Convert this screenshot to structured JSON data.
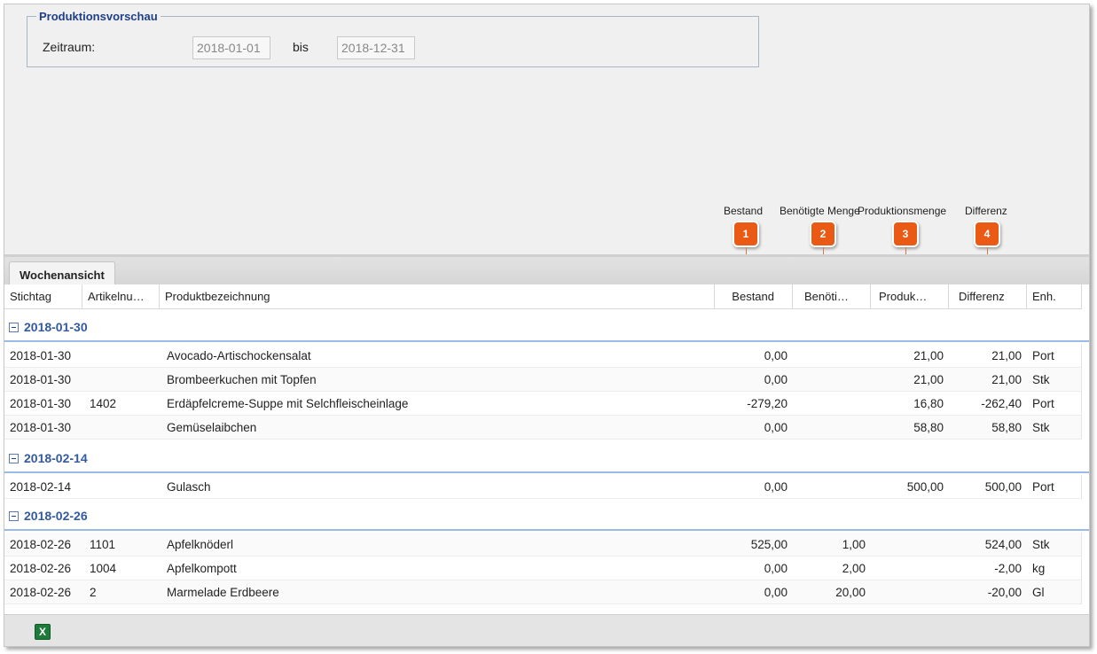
{
  "filter": {
    "legend": "Produktionsvorschau",
    "period_label": "Zeitraum:",
    "date_from": "2018-01-01",
    "to_label": "bis",
    "date_to": "2018-12-31"
  },
  "callouts": [
    {
      "number": "1",
      "label": "Bestand"
    },
    {
      "number": "2",
      "label": "Benötigte Menge"
    },
    {
      "number": "3",
      "label": "Produktionsmenge"
    },
    {
      "number": "4",
      "label": "Differenz"
    }
  ],
  "tabs": [
    {
      "label": "Wochenansicht"
    }
  ],
  "columns": {
    "stichtag": "Stichtag",
    "artikelnummer": "Artikelnu…",
    "produktbezeichnung": "Produktbezeichnung",
    "bestand": "Bestand",
    "benoetigt": "Benöti…",
    "produktion": "Produk…",
    "differenz": "Differenz",
    "einheit": "Enh."
  },
  "groups": [
    {
      "title": "2018-01-30",
      "rows": [
        {
          "stichtag": "2018-01-30",
          "artikelnummer": "",
          "produkt": "Avocado-Artischockensalat",
          "bestand": "0,00",
          "benoetigt": "",
          "produktion": "21,00",
          "differenz": "21,00",
          "einheit": "Port"
        },
        {
          "stichtag": "2018-01-30",
          "artikelnummer": "",
          "produkt": "Brombeerkuchen mit Topfen",
          "bestand": "0,00",
          "benoetigt": "",
          "produktion": "21,00",
          "differenz": "21,00",
          "einheit": "Stk"
        },
        {
          "stichtag": "2018-01-30",
          "artikelnummer": "1402",
          "produkt": "Erdäpfelcreme-Suppe mit Selchfleischeinlage",
          "bestand": "-279,20",
          "benoetigt": "",
          "produktion": "16,80",
          "differenz": "-262,40",
          "einheit": "Port"
        },
        {
          "stichtag": "2018-01-30",
          "artikelnummer": "",
          "produkt": "Gemüselaibchen",
          "bestand": "0,00",
          "benoetigt": "",
          "produktion": "58,80",
          "differenz": "58,80",
          "einheit": "Stk"
        }
      ]
    },
    {
      "title": "2018-02-14",
      "rows": [
        {
          "stichtag": "2018-02-14",
          "artikelnummer": "",
          "produkt": "Gulasch",
          "bestand": "0,00",
          "benoetigt": "",
          "produktion": "500,00",
          "differenz": "500,00",
          "einheit": "Port"
        }
      ]
    },
    {
      "title": "2018-02-26",
      "rows": [
        {
          "stichtag": "2018-02-26",
          "artikelnummer": "1101",
          "produkt": "Apfelknöderl",
          "bestand": "525,00",
          "benoetigt": "1,00",
          "produktion": "",
          "differenz": "524,00",
          "einheit": "Stk"
        },
        {
          "stichtag": "2018-02-26",
          "artikelnummer": "1004",
          "produkt": "Apfelkompott",
          "bestand": "0,00",
          "benoetigt": "2,00",
          "produktion": "",
          "differenz": "-2,00",
          "einheit": "kg"
        },
        {
          "stichtag": "2018-02-26",
          "artikelnummer": "2",
          "produkt": "Marmelade Erdbeere",
          "bestand": "0,00",
          "benoetigt": "20,00",
          "produktion": "",
          "differenz": "-20,00",
          "einheit": "Gl"
        }
      ]
    }
  ],
  "toolbar": {
    "excel_icon": "excel-export-icon"
  },
  "colors": {
    "accent": "#1f3f87",
    "callout": "#ea5a14",
    "group_border": "#99bbe8"
  }
}
